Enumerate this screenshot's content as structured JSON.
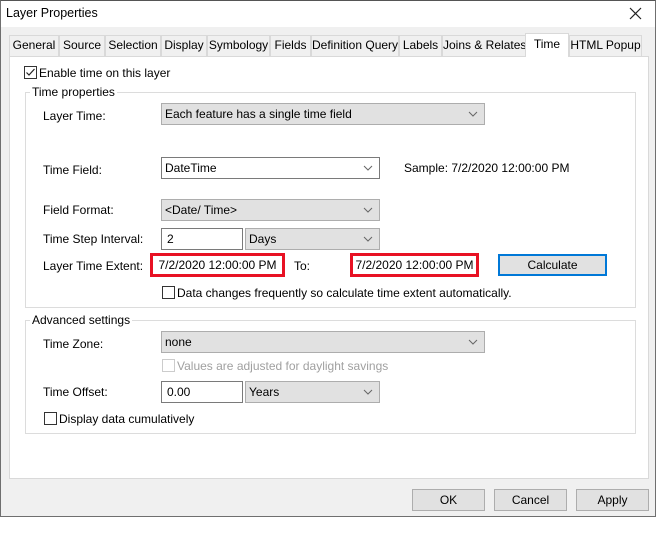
{
  "window": {
    "title": "Layer Properties",
    "close_icon": "close-icon"
  },
  "tabs": [
    {
      "label": "General",
      "active": false
    },
    {
      "label": "Source",
      "active": false
    },
    {
      "label": "Selection",
      "active": false
    },
    {
      "label": "Display",
      "active": false
    },
    {
      "label": "Symbology",
      "active": false
    },
    {
      "label": "Fields",
      "active": false
    },
    {
      "label": "Definition Query",
      "active": false
    },
    {
      "label": "Labels",
      "active": false
    },
    {
      "label": "Joins & Relates",
      "active": false
    },
    {
      "label": "Time",
      "active": true
    },
    {
      "label": "HTML Popup",
      "active": false
    }
  ],
  "enable_time": {
    "label": "Enable time on this layer",
    "checked": true
  },
  "time_properties": {
    "group_label": "Time properties",
    "layer_time": {
      "label": "Layer Time:",
      "value": "Each feature has a single time field"
    },
    "time_field": {
      "label": "Time Field:",
      "value": "DateTime",
      "sample": "Sample: 7/2/2020 12:00:00 PM"
    },
    "field_format": {
      "label": "Field Format:",
      "value": "<Date/ Time>"
    },
    "time_step": {
      "label": "Time Step Interval:",
      "value": "2",
      "unit": "Days"
    },
    "extent": {
      "label": "Layer Time Extent:",
      "start": "7/2/2020 12:00:00 PM",
      "to_label": "To:",
      "end": "7/2/2020 12:00:00 PM",
      "calculate_label": "Calculate",
      "highlight_color": "#e81123"
    },
    "auto_calc": {
      "label": "Data changes frequently so calculate time extent automatically.",
      "checked": false
    }
  },
  "advanced": {
    "group_label": "Advanced settings",
    "time_zone": {
      "label": "Time Zone:",
      "value": "none"
    },
    "daylight": {
      "label": "Values are adjusted for daylight savings",
      "checked": false,
      "disabled": true
    },
    "time_offset": {
      "label": "Time Offset:",
      "value": "0.00",
      "unit": "Years"
    },
    "cumulative": {
      "label": "Display data cumulatively",
      "checked": false
    }
  },
  "footer": {
    "ok_label": "OK",
    "cancel_label": "Cancel",
    "apply_label": "Apply"
  }
}
